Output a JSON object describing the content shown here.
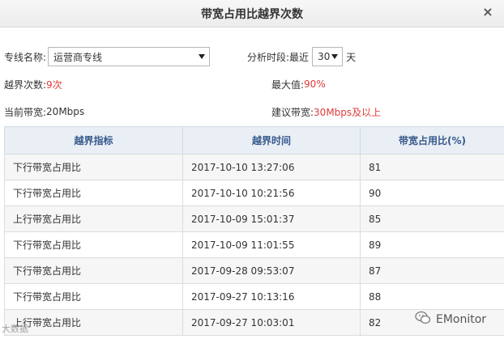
{
  "dialog": {
    "title": "带宽占用比越界次数",
    "close_glyph": "×"
  },
  "form": {
    "line_label": "专线名称:",
    "line_value": "运营商专线",
    "period_label": "分析时段:",
    "period_prefix": "最近",
    "period_value": "30",
    "period_unit": "天"
  },
  "summary": {
    "exceed_label": "越界次数:",
    "exceed_value": "9次",
    "max_label": "最大值:",
    "max_value": "90%",
    "current_label": "当前带宽:",
    "current_value": "20Mbps",
    "suggest_label": "建议带宽:",
    "suggest_value": "30Mbps及以上"
  },
  "table": {
    "columns": [
      "越界指标",
      "越界时间",
      "带宽占用比(%)"
    ],
    "rows": [
      [
        "下行带宽占用比",
        "2017-10-10 13:27:06",
        "81"
      ],
      [
        "下行带宽占用比",
        "2017-10-10 10:21:56",
        "90"
      ],
      [
        "上行带宽占用比",
        "2017-10-09 15:01:37",
        "85"
      ],
      [
        "下行带宽占用比",
        "2017-10-09 11:01:55",
        "89"
      ],
      [
        "下行带宽占用比",
        "2017-09-28 09:53:07",
        "87"
      ],
      [
        "下行带宽占用比",
        "2017-09-27 10:13:16",
        "88"
      ],
      [
        "上行带宽占用比",
        "2017-09-27 10:03:01",
        "82"
      ]
    ]
  },
  "watermark": {
    "left_text": "大数据",
    "right_text": "EMonitor"
  },
  "colors": {
    "highlight_red": "#e03b3b",
    "header_text": "#36598c",
    "header_bg": "#e9eff5"
  }
}
